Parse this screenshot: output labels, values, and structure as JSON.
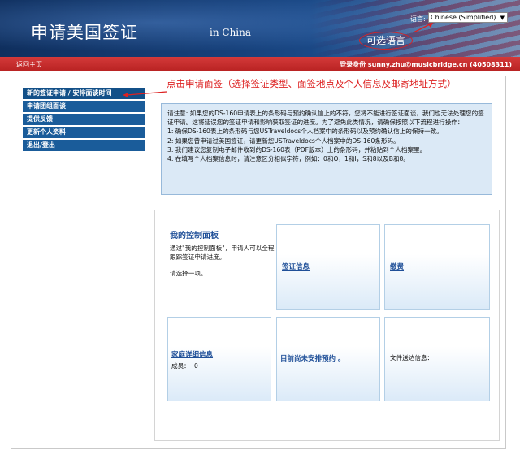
{
  "header": {
    "title": "申请美国签证",
    "subtitle": "in China",
    "language_label": "语言:",
    "language_selected": "Chinese (Simplified)",
    "language_annotation": "可选语言"
  },
  "navbar": {
    "home": "返回主页",
    "user": "登录身份 sunny.zhu@musicbridge.cn (40508311)"
  },
  "sidebar": {
    "items": [
      {
        "label": "新的签证申请 / 安排面谈时间"
      },
      {
        "label": "申请团组面谈"
      },
      {
        "label": "提供反馈"
      },
      {
        "label": "更新个人资料"
      },
      {
        "label": "退出/登出"
      }
    ],
    "annotation": "点击申请面签（选择签证类型、面签地点及个人信息及邮寄地址方式）"
  },
  "notice": {
    "lines": [
      "请注意: 如果您的DS-160申请表上的条形码与预约确认信上的不符，您将不能进行签证面谈，我们也无法处理您的签证申请。这将延误您的签证申请和影响获取签证的进度。为了避免此类情况，请确保按照以下流程进行操作：",
      "1: 确保DS-160表上的条形码与您USTraveldocs个人档案中的条形码以及预约确认信上的保持一致。",
      "2: 如果您曾申请过美国签证，请更新您USTraveldocs个人档案中的DS-160条形码。",
      "3: 我们建议您复制电子邮件收到的DS-160表（PDF版本）上的条形码，并粘贴到个人档案里。",
      "4: 在填写个人档案信息时，请注意区分相似字符，例如：0和O，1和I，S和8以及B和8。"
    ]
  },
  "dashboard": {
    "control_title": "我的控制面板",
    "control_desc": "通过\"我的控制面板\"，申请人可以全程跟踪签证申请进度。",
    "control_prompt": "请选择一项。",
    "visa_info": "签证信息",
    "payment": "缴费",
    "family_details": "家庭详细信息",
    "members_label": "成员：",
    "members_value": "0",
    "no_appointment": "目前尚未安排预约 。",
    "delivery_info": "文件送达信息："
  },
  "colors": {
    "banner": "#16407a",
    "navbar": "#c02a2a",
    "sidebar": "#1a5c9a",
    "annotation": "#dd2222",
    "link": "#1f4f98"
  }
}
